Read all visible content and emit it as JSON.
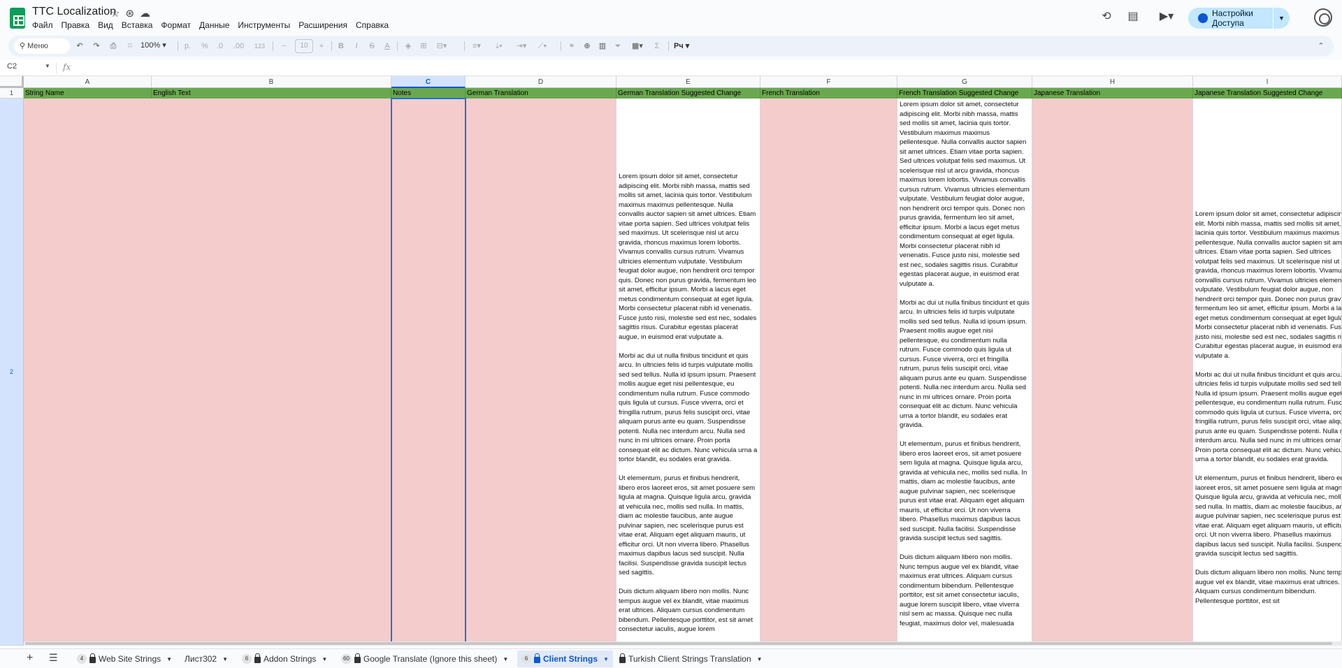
{
  "doc": {
    "title": "TTC Localization"
  },
  "menu": [
    "Файл",
    "Правка",
    "Вид",
    "Вставка",
    "Формат",
    "Данные",
    "Инструменты",
    "Расширения",
    "Справка"
  ],
  "share": {
    "label": "Настройки Доступа"
  },
  "toolbar": {
    "search_label": "Меню",
    "zoom": "100%",
    "currency": "р.",
    "percent": "%",
    "dec_dec": ".0",
    "dec_inc": ".00",
    "number_format": "123",
    "font_size": "10",
    "input_lang": "Рч"
  },
  "formula": {
    "cell_ref": "C2",
    "fx": "fx",
    "content": ""
  },
  "grid": {
    "columns": [
      "A",
      "B",
      "C",
      "D",
      "E",
      "F",
      "G",
      "H",
      "I"
    ],
    "rows": [
      "1",
      "2"
    ],
    "headers": [
      "String Name",
      "English Text",
      "Notes",
      "German Translation",
      "German Translation Suggested Change",
      "French Translation",
      "French Translation Suggested Change",
      "Japanese Translation",
      "Japanese Translation Suggested Change"
    ],
    "german_suggested": "Lorem ipsum dolor sit amet, consectetur adipiscing elit. Morbi nibh massa, mattis sed mollis sit amet, lacinia quis tortor. Vestibulum maximus maximus pellentesque. Nulla convallis auctor sapien sit amet ultrices. Etiam vitae porta sapien. Sed ultrices volutpat felis sed maximus. Ut scelerisque nisl ut arcu gravida, rhoncus maximus lorem lobortis. Vivamus convallis cursus rutrum. Vivamus ultricies elementum vulputate. Vestibulum feugiat dolor augue, non hendrerit orci tempor quis. Donec non purus gravida, fermentum leo sit amet, efficitur ipsum. Morbi a lacus eget metus condimentum consequat at eget ligula. Morbi consectetur placerat nibh id venenatis. Fusce justo nisi, molestie sed est nec, sodales sagittis risus. Curabitur egestas placerat augue, in euismod erat vulputate a.\n\nMorbi ac dui ut nulla finibus tincidunt et quis arcu. In ultricies felis id turpis vulputate mollis sed sed tellus. Nulla id ipsum ipsum. Praesent mollis augue eget nisi pellentesque, eu condimentum nulla rutrum. Fusce commodo quis ligula ut cursus. Fusce viverra, orci et fringilla rutrum, purus felis suscipit orci, vitae aliquam purus ante eu quam. Suspendisse potenti. Nulla nec interdum arcu. Nulla sed nunc in mi ultrices ornare. Proin porta consequat elit ac dictum. Nunc vehicula urna a tortor blandit, eu sodales erat gravida.\n\nUt elementum, purus et finibus hendrerit, libero eros laoreet eros, sit amet posuere sem ligula at magna. Quisque ligula arcu, gravida at vehicula nec, mollis sed nulla. In mattis, diam ac molestie faucibus, ante augue pulvinar sapien, nec scelerisque purus est vitae erat. Aliquam eget aliquam mauris, ut efficitur orci. Ut non viverra libero. Phasellus maximus dapibus lacus sed suscipit. Nulla facilisi. Suspendisse gravida suscipit lectus sed sagittis.\n\nDuis dictum aliquam libero non mollis. Nunc tempus augue vel ex blandit, vitae maximus erat ultrices. Aliquam cursus condimentum bibendum. Pellentesque porttitor, est sit amet consectetur iaculis, augue lorem",
    "french_suggested": "Lorem ipsum dolor sit amet, consectetur adipiscing elit. Morbi nibh massa, mattis sed mollis sit amet, lacinia quis tortor. Vestibulum maximus maximus pellentesque. Nulla convallis auctor sapien sit amet ultrices. Etiam vitae porta sapien. Sed ultrices volutpat felis sed maximus. Ut scelerisque nisl ut arcu gravida, rhoncus maximus lorem lobortis. Vivamus convallis cursus rutrum. Vivamus ultricies elementum vulputate. Vestibulum feugiat dolor augue, non hendrerit orci tempor quis. Donec non purus gravida, fermentum leo sit amet, efficitur ipsum. Morbi a lacus eget metus condimentum consequat at eget ligula. Morbi consectetur placerat nibh id venenatis. Fusce justo nisi, molestie sed est nec, sodales sagittis risus. Curabitur egestas placerat augue, in euismod erat vulputate a.\n\nMorbi ac dui ut nulla finibus tincidunt et quis arcu. In ultricies felis id turpis vulputate mollis sed sed tellus. Nulla id ipsum ipsum. Praesent mollis augue eget nisi pellentesque, eu condimentum nulla rutrum. Fusce commodo quis ligula ut cursus. Fusce viverra, orci et fringilla rutrum, purus felis suscipit orci, vitae aliquam purus ante eu quam. Suspendisse potenti. Nulla nec interdum arcu. Nulla sed nunc in mi ultrices ornare. Proin porta consequat elit ac dictum. Nunc vehicula urna a tortor blandit, eu sodales erat gravida.\n\nUt elementum, purus et finibus hendrerit, libero eros laoreet eros, sit amet posuere sem ligula at magna. Quisque ligula arcu, gravida at vehicula nec, mollis sed nulla. In mattis, diam ac molestie faucibus, ante augue pulvinar sapien, nec scelerisque purus est vitae erat. Aliquam eget aliquam mauris, ut efficitur orci. Ut non viverra libero. Phasellus maximus dapibus lacus sed suscipit. Nulla facilisi. Suspendisse gravida suscipit lectus sed sagittis.\n\nDuis dictum aliquam libero non mollis. Nunc tempus augue vel ex blandit, vitae maximus erat ultrices. Aliquam cursus condimentum bibendum. Pellentesque porttitor, est sit amet consectetur iaculis, augue lorem suscipit libero, vitae viverra nisl sem ac massa. Quisque nec nulla feugiat, maximus dolor vel, malesuada",
    "japanese_suggested": "Lorem ipsum dolor sit amet, consectetur adipiscing elit. Morbi nibh massa, mattis sed mollis sit amet, lacinia quis tortor. Vestibulum maximus maximus pellentesque. Nulla convallis auctor sapien sit amet ultrices. Etiam vitae porta sapien. Sed ultrices volutpat felis sed maximus. Ut scelerisque nisl ut arcu gravida, rhoncus maximus lorem lobortis. Vivamus convallis cursus rutrum. Vivamus ultricies elementum vulputate. Vestibulum feugiat dolor augue, non hendrerit orci tempor quis. Donec non purus gravida, fermentum leo sit amet, efficitur ipsum. Morbi a lacus eget metus condimentum consequat at eget ligula. Morbi consectetur placerat nibh id venenatis. Fusce justo nisi, molestie sed est nec, sodales sagittis risus. Curabitur egestas placerat augue, in euismod erat vulputate a.\n\nMorbi ac dui ut nulla finibus tincidunt et quis arcu. In ultricies felis id turpis vulputate mollis sed sed tellus. Nulla id ipsum ipsum. Praesent mollis augue eget nisi pellentesque, eu condimentum nulla rutrum. Fusce commodo quis ligula ut cursus. Fusce viverra, orci et fringilla rutrum, purus felis suscipit orci, vitae aliquam purus ante eu quam. Suspendisse potenti. Nulla nec interdum arcu. Nulla sed nunc in mi ultrices ornare. Proin porta consequat elit ac dictum. Nunc vehicula urna a tortor blandit, eu sodales erat gravida.\n\nUt elementum, purus et finibus hendrerit, libero eros laoreet eros, sit amet posuere sem ligula at magna. Quisque ligula arcu, gravida at vehicula nec, mollis sed nulla. In mattis, diam ac molestie faucibus, ante augue pulvinar sapien, nec scelerisque purus est vitae erat. Aliquam eget aliquam mauris, ut efficitur orci. Ut non viverra libero. Phasellus maximus dapibus lacus sed suscipit. Nulla facilisi. Suspendisse gravida suscipit lectus sed sagittis.\n\nDuis dictum aliquam libero non mollis. Nunc tempus augue vel ex blandit, vitae maximus erat ultrices. Aliquam cursus condimentum bibendum. Pellentesque porttitor, est sit"
  },
  "sheets": [
    {
      "badge": "4",
      "locked": true,
      "name": "Web Site Strings",
      "active": false
    },
    {
      "badge": "",
      "locked": false,
      "name": "Лист302",
      "active": false
    },
    {
      "badge": "6",
      "locked": true,
      "name": "Addon Strings",
      "active": false
    },
    {
      "badge": "60",
      "locked": true,
      "name": "Google Translate (Ignore this sheet)",
      "active": false
    },
    {
      "badge": "6",
      "locked": true,
      "name": "Client Strings",
      "active": true
    },
    {
      "badge": "",
      "locked": true,
      "name": "Turkish Client Strings Translation",
      "active": false
    }
  ],
  "colors": {
    "header_green": "#6aa84f",
    "pink_fill": "#f4cccc",
    "accent": "#0b57d0",
    "share_bg": "#c2e7ff"
  }
}
